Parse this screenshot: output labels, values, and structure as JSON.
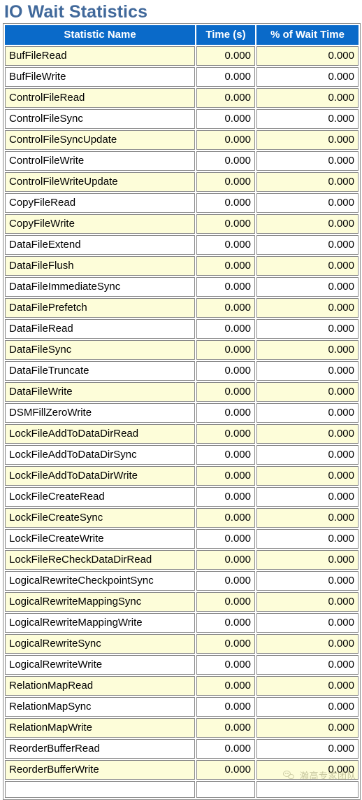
{
  "page": {
    "title": "IO Wait Statistics"
  },
  "table": {
    "columns": [
      "Statistic Name",
      "Time (s)",
      "% of Wait Time"
    ],
    "rows": [
      {
        "name": "BufFileRead",
        "time": "0.000",
        "pct": "0.000"
      },
      {
        "name": "BufFileWrite",
        "time": "0.000",
        "pct": "0.000"
      },
      {
        "name": "ControlFileRead",
        "time": "0.000",
        "pct": "0.000"
      },
      {
        "name": "ControlFileSync",
        "time": "0.000",
        "pct": "0.000"
      },
      {
        "name": "ControlFileSyncUpdate",
        "time": "0.000",
        "pct": "0.000"
      },
      {
        "name": "ControlFileWrite",
        "time": "0.000",
        "pct": "0.000"
      },
      {
        "name": "ControlFileWriteUpdate",
        "time": "0.000",
        "pct": "0.000"
      },
      {
        "name": "CopyFileRead",
        "time": "0.000",
        "pct": "0.000"
      },
      {
        "name": "CopyFileWrite",
        "time": "0.000",
        "pct": "0.000"
      },
      {
        "name": "DataFileExtend",
        "time": "0.000",
        "pct": "0.000"
      },
      {
        "name": "DataFileFlush",
        "time": "0.000",
        "pct": "0.000"
      },
      {
        "name": "DataFileImmediateSync",
        "time": "0.000",
        "pct": "0.000"
      },
      {
        "name": "DataFilePrefetch",
        "time": "0.000",
        "pct": "0.000"
      },
      {
        "name": "DataFileRead",
        "time": "0.000",
        "pct": "0.000"
      },
      {
        "name": "DataFileSync",
        "time": "0.000",
        "pct": "0.000"
      },
      {
        "name": "DataFileTruncate",
        "time": "0.000",
        "pct": "0.000"
      },
      {
        "name": "DataFileWrite",
        "time": "0.000",
        "pct": "0.000"
      },
      {
        "name": "DSMFillZeroWrite",
        "time": "0.000",
        "pct": "0.000"
      },
      {
        "name": "LockFileAddToDataDirRead",
        "time": "0.000",
        "pct": "0.000"
      },
      {
        "name": "LockFileAddToDataDirSync",
        "time": "0.000",
        "pct": "0.000"
      },
      {
        "name": "LockFileAddToDataDirWrite",
        "time": "0.000",
        "pct": "0.000"
      },
      {
        "name": "LockFileCreateRead",
        "time": "0.000",
        "pct": "0.000"
      },
      {
        "name": "LockFileCreateSync",
        "time": "0.000",
        "pct": "0.000"
      },
      {
        "name": "LockFileCreateWrite",
        "time": "0.000",
        "pct": "0.000"
      },
      {
        "name": "LockFileReCheckDataDirRead",
        "time": "0.000",
        "pct": "0.000"
      },
      {
        "name": "LogicalRewriteCheckpointSync",
        "time": "0.000",
        "pct": "0.000"
      },
      {
        "name": "LogicalRewriteMappingSync",
        "time": "0.000",
        "pct": "0.000"
      },
      {
        "name": "LogicalRewriteMappingWrite",
        "time": "0.000",
        "pct": "0.000"
      },
      {
        "name": "LogicalRewriteSync",
        "time": "0.000",
        "pct": "0.000"
      },
      {
        "name": "LogicalRewriteWrite",
        "time": "0.000",
        "pct": "0.000"
      },
      {
        "name": "RelationMapRead",
        "time": "0.000",
        "pct": "0.000"
      },
      {
        "name": "RelationMapSync",
        "time": "0.000",
        "pct": "0.000"
      },
      {
        "name": "RelationMapWrite",
        "time": "0.000",
        "pct": "0.000"
      },
      {
        "name": "ReorderBufferRead",
        "time": "0.000",
        "pct": "0.000"
      },
      {
        "name": "ReorderBufferWrite",
        "time": "0.000",
        "pct": "0.000"
      },
      {
        "name": "",
        "time": "",
        "pct": ""
      }
    ]
  },
  "watermark": {
    "text": "瀚高专家团队",
    "logo": "wechat-icon"
  },
  "colors": {
    "title": "#41699b",
    "header_bg": "#0a6ac9",
    "header_text": "#ffffff",
    "row_alt_bg": "#fdfdd9",
    "row_bg": "#ffffff",
    "border": "#8a8a8a"
  }
}
